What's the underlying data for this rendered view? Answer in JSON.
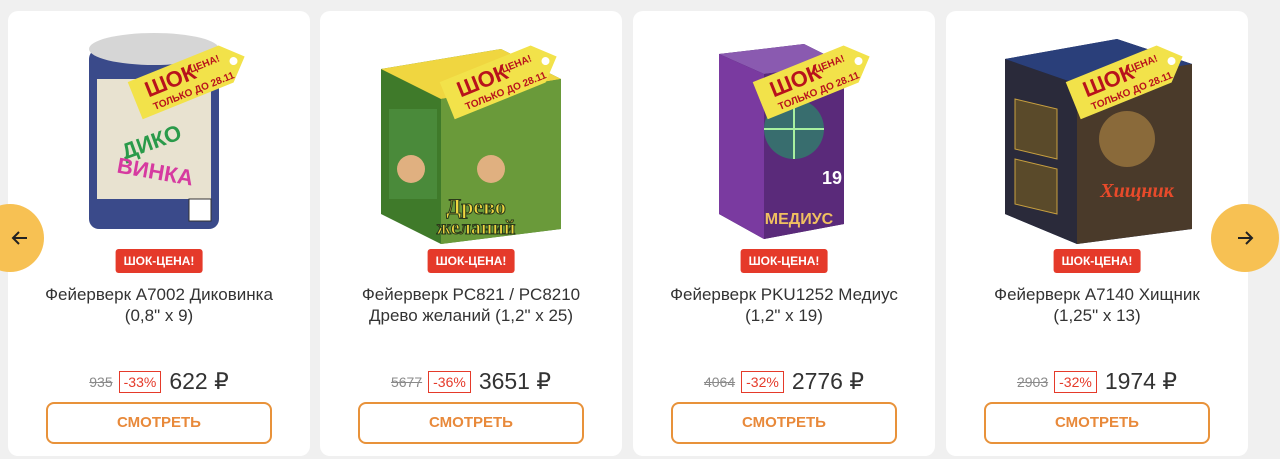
{
  "products": [
    {
      "badge": "ШОК-ЦЕНА!",
      "title_line1": "Фейерверк A7002 Диковинка",
      "title_line2": "(0,8\" x 9)",
      "old_price": "935",
      "discount": "-33%",
      "price": "622 ₽",
      "button": "СМОТРЕТЬ",
      "tag_line1": "ШОК",
      "tag_line2": "ЦЕНА!",
      "tag_line3": "ТОЛЬКО ДО 28.11",
      "box_text": "ДИКОВИНКА",
      "box_color": "#c9c9c9"
    },
    {
      "badge": "ШОК-ЦЕНА!",
      "title_line1": "Фейерверк PC821 / PC8210",
      "title_line2": "Древо желаний (1,2\" x 25)",
      "old_price": "5677",
      "discount": "-36%",
      "price": "3651 ₽",
      "button": "СМОТРЕТЬ",
      "tag_line1": "ШОК",
      "tag_line2": "ЦЕНА!",
      "tag_line3": "ТОЛЬКО ДО 28.11",
      "box_text": "Древо желаний",
      "box_color": "#d9c23a"
    },
    {
      "badge": "ШОК-ЦЕНА!",
      "title_line1": "Фейерверк PKU1252 Медиус",
      "title_line2": "(1,2\" x 19)",
      "old_price": "4064",
      "discount": "-32%",
      "price": "2776 ₽",
      "button": "СМОТРЕТЬ",
      "tag_line1": "ШОК",
      "tag_line2": "ЦЕНА!",
      "tag_line3": "ТОЛЬКО ДО 28.11",
      "box_text": "МЕДИУС",
      "box_color": "#5a2a7a"
    },
    {
      "badge": "ШОК-ЦЕНА!",
      "title_line1": "Фейерверк A7140 Хищник",
      "title_line2": "(1,25\" x 13)",
      "old_price": "2903",
      "discount": "-32%",
      "price": "1974 ₽",
      "button": "СМОТРЕТЬ",
      "tag_line1": "ШОК",
      "tag_line2": "ЦЕНА!",
      "tag_line3": "ТОЛЬКО ДО 28.11",
      "box_text": "Хищник",
      "box_color": "#1e2f5c"
    }
  ],
  "nav": {
    "prev_icon": "arrow-left-icon",
    "next_icon": "arrow-right-icon"
  },
  "colors": {
    "accent": "#f7c153",
    "badge": "#e53a2a",
    "button_border": "#e8923a"
  }
}
